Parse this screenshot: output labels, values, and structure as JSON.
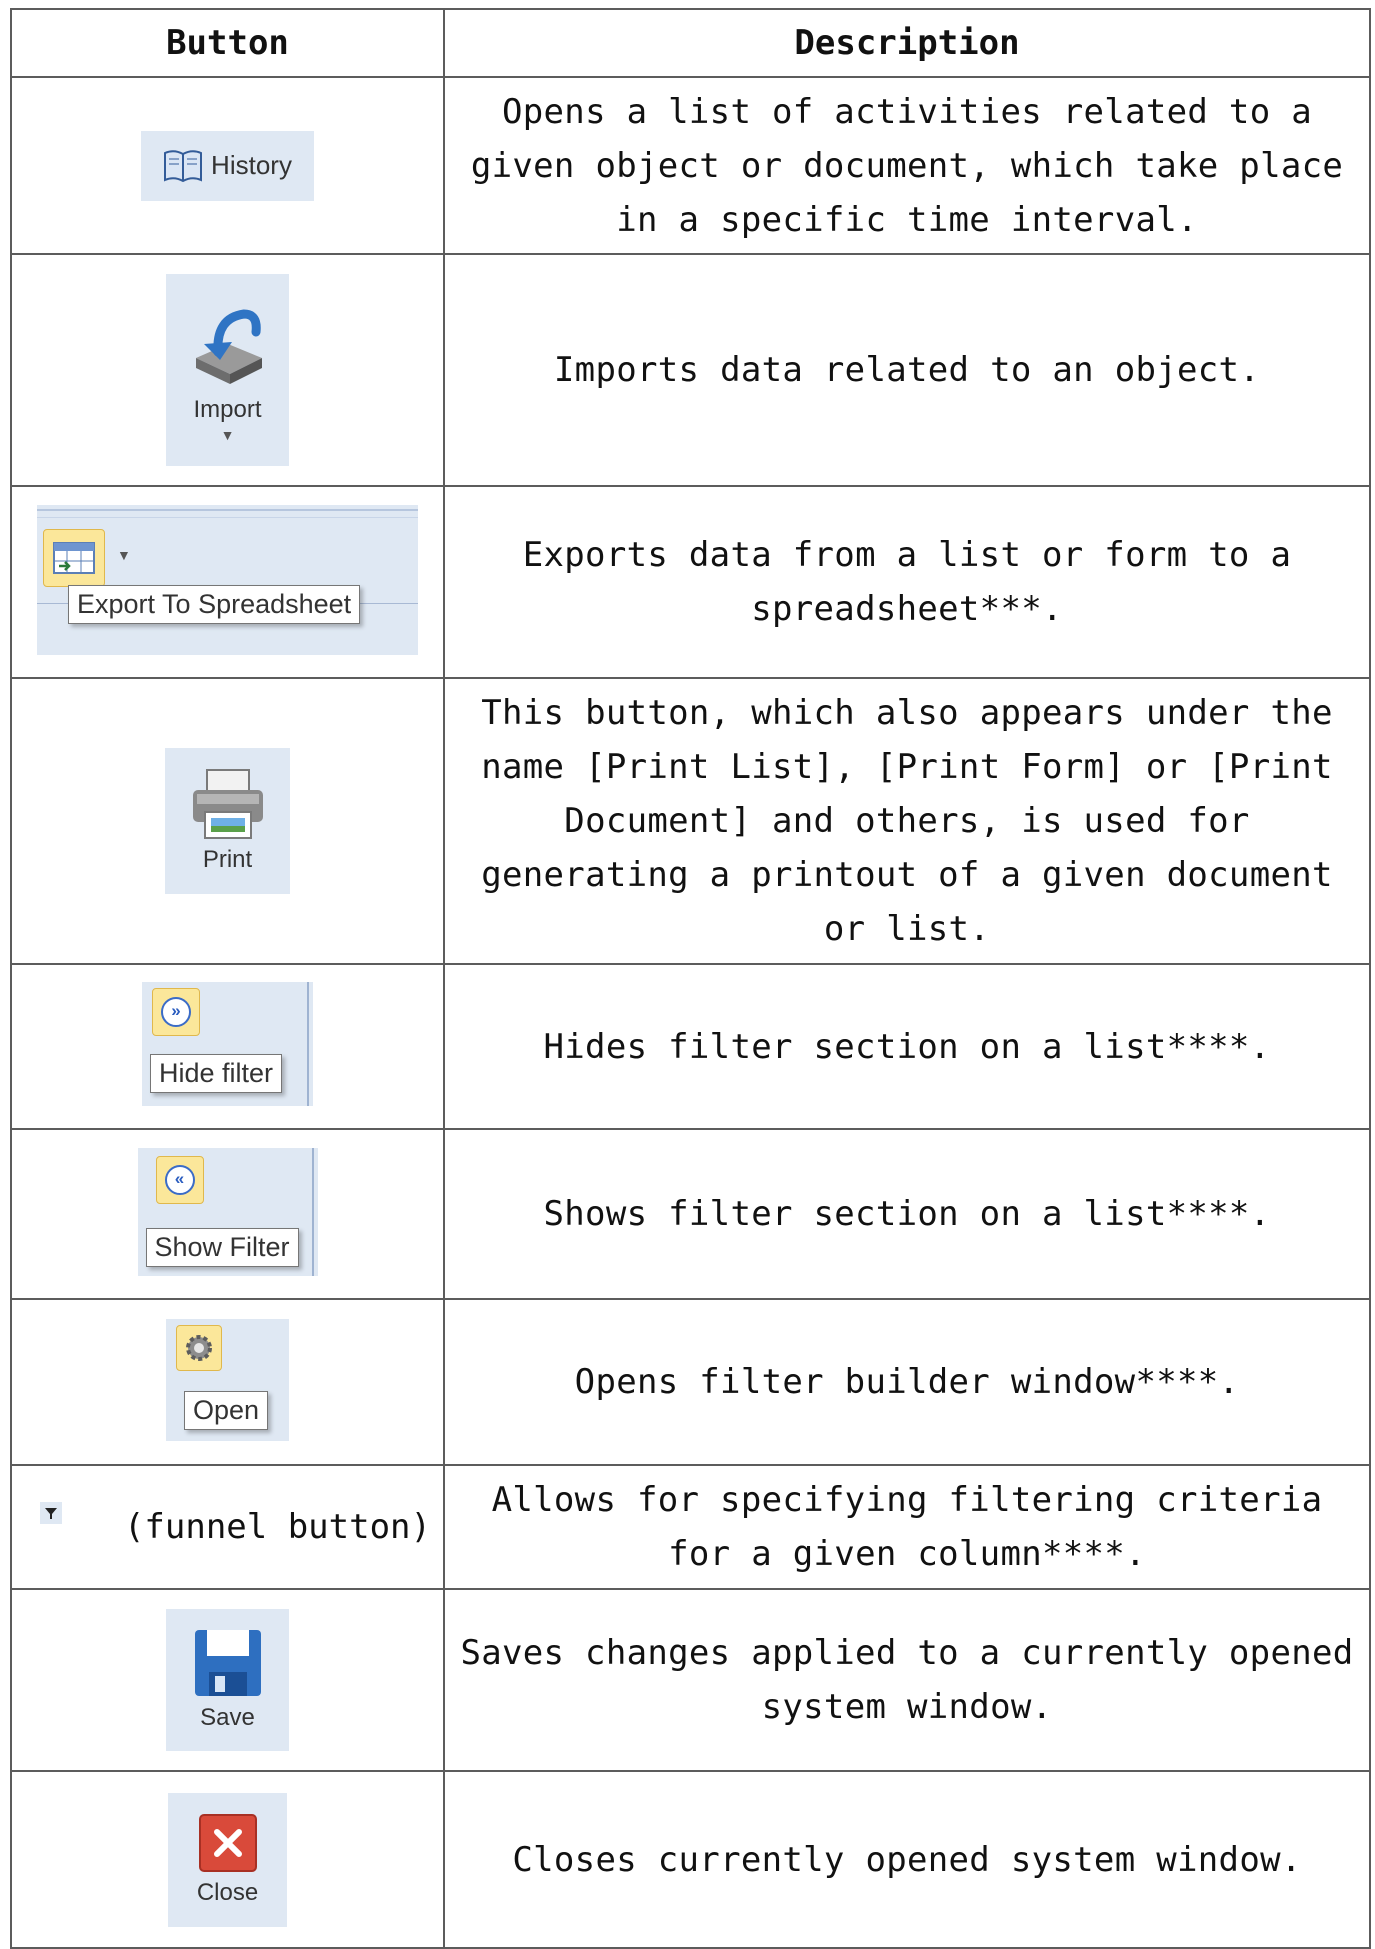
{
  "headers": {
    "button": "Button",
    "description": "Description"
  },
  "rows": [
    {
      "button_label": "History",
      "icon": "book-icon",
      "description": "Opens a list of activities related to a given object or document, which take place in a specific time interval."
    },
    {
      "button_label": "Import",
      "icon": "import-icon",
      "description": "Imports data related to an object."
    },
    {
      "button_label": "Export To Spreadsheet",
      "icon": "spreadsheet-export-icon",
      "description": "Exports data from a list or form to a spreadsheet***."
    },
    {
      "button_label": "Print",
      "icon": "printer-icon",
      "description": "This button, which also appears under the name [Print List], [Print Form] or [Print Document] and others, is used for generating a printout of a given document or list."
    },
    {
      "button_label": "Hide filter",
      "icon": "chevron-double-down-icon",
      "description": "Hides filter section on a list****."
    },
    {
      "button_label": "Show Filter",
      "icon": "chevron-double-up-icon",
      "description": "Shows filter section on a list****."
    },
    {
      "button_label": "Open",
      "icon": "gear-icon",
      "description": "Opens filter builder window****."
    },
    {
      "button_label": "(funnel button)",
      "icon": "funnel-icon",
      "description": "Allows for specifying filtering criteria for a given column****."
    },
    {
      "button_label": "Save",
      "icon": "floppy-disk-icon",
      "description": "Saves changes applied to a currently opened system window."
    },
    {
      "button_label": "Close",
      "icon": "close-icon",
      "description": "Closes currently opened system window."
    }
  ]
}
